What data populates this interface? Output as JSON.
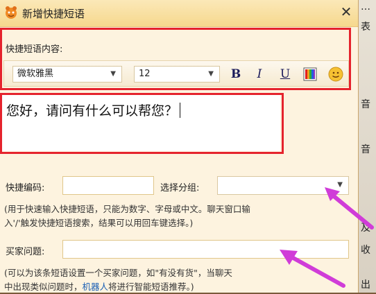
{
  "dialog": {
    "title": "新增快捷短语",
    "close_glyph": "✕"
  },
  "background": {
    "right_chars": [
      "…",
      "表",
      "音",
      "音",
      "及",
      "收",
      "出"
    ]
  },
  "content_section": {
    "label": "快捷短语内容:",
    "font_family": "微软雅黑",
    "font_size": "12",
    "bold_label": "B",
    "italic_label": "I",
    "underline_label": "U",
    "color_icon": "color-palette-icon",
    "emoji_icon": "smiley-icon",
    "text": "您好，请问有什么可以帮您？"
  },
  "code_row": {
    "code_label": "快捷编码:",
    "code_value": "",
    "group_label": "选择分组:",
    "group_value": ""
  },
  "code_hint": {
    "line1": "(用于快速输入快捷短语，只能为数字、字母或中文。聊天窗口输",
    "line2": "入'/'触发快捷短语搜索，结果可以用回车键选择。)"
  },
  "question_row": {
    "label": "买家问题:",
    "value": ""
  },
  "question_hint": {
    "line1": "(可以为该条短语设置一个买家问题，如\"有没有货\"，当聊天",
    "line2_a": "中出现类似问题时，",
    "link": "机器人",
    "line2_b": "将进行智能短语推荐。)"
  },
  "colors": {
    "highlight_red": "#e5232d",
    "arrow_magenta": "#d03cd8",
    "dialog_bg": "#fdf3df"
  }
}
